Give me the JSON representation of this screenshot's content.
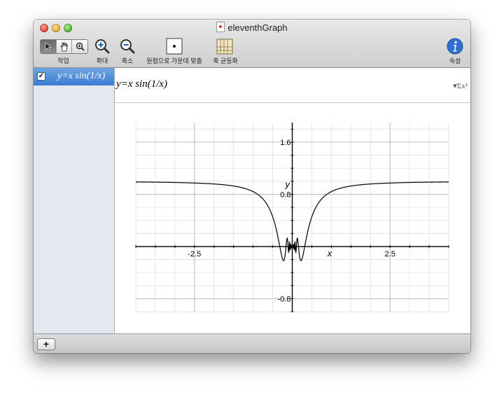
{
  "window": {
    "title": "eleventhGraph"
  },
  "toolbar": {
    "tools_label": "작업",
    "zoom_in_label": "확대",
    "zoom_out_label": "축소",
    "center_origin_label": "원점으로 가운데 맞춤",
    "equalize_axes_label": "축 균등화",
    "inspector_label": "속성"
  },
  "sidebar": {
    "items": [
      {
        "checked": true,
        "equation": "y=x sin(1/x)"
      }
    ]
  },
  "equation_bar": {
    "equation": "y=x sin(1/x)"
  },
  "colors": {
    "selection": "#3b7bd0",
    "curve": "#000000",
    "grid": "#d8d8d8"
  },
  "chart_data": {
    "type": "line",
    "title": "",
    "xlabel": "x",
    "ylabel": "y",
    "xlim": [
      -4.0,
      4.0
    ],
    "ylim": [
      -1.0,
      1.9
    ],
    "x_ticks": [
      -2.5,
      2.5
    ],
    "y_ticks": [
      1.6,
      0.8,
      -0.8
    ],
    "tick_labels": {
      "x": [
        "-2.5",
        "2.5"
      ],
      "y": [
        "1.6",
        "0.8",
        "-0.8"
      ]
    },
    "grid": true,
    "series": [
      {
        "function": "y = x*sin(1/x)",
        "x": [
          -4.0,
          -3.0,
          -2.5,
          -2.0,
          -1.5,
          -1.0,
          -0.8,
          -0.6,
          -0.5,
          -0.4,
          -0.3,
          -0.25,
          -0.2,
          -0.15,
          -0.1,
          -0.05,
          0.05,
          0.1,
          0.15,
          0.2,
          0.25,
          0.3,
          0.4,
          0.5,
          0.6,
          0.8,
          1.0,
          1.5,
          2.0,
          2.5,
          3.0,
          4.0
        ],
        "y": [
          0.99,
          0.981,
          0.973,
          0.959,
          0.927,
          0.841,
          0.759,
          0.597,
          0.455,
          0.239,
          -0.058,
          -0.189,
          -0.192,
          0.056,
          -0.054,
          0.046,
          0.046,
          -0.054,
          0.056,
          -0.192,
          -0.189,
          -0.058,
          0.239,
          0.455,
          0.597,
          0.759,
          0.841,
          0.927,
          0.959,
          0.973,
          0.981,
          0.99
        ]
      }
    ]
  }
}
